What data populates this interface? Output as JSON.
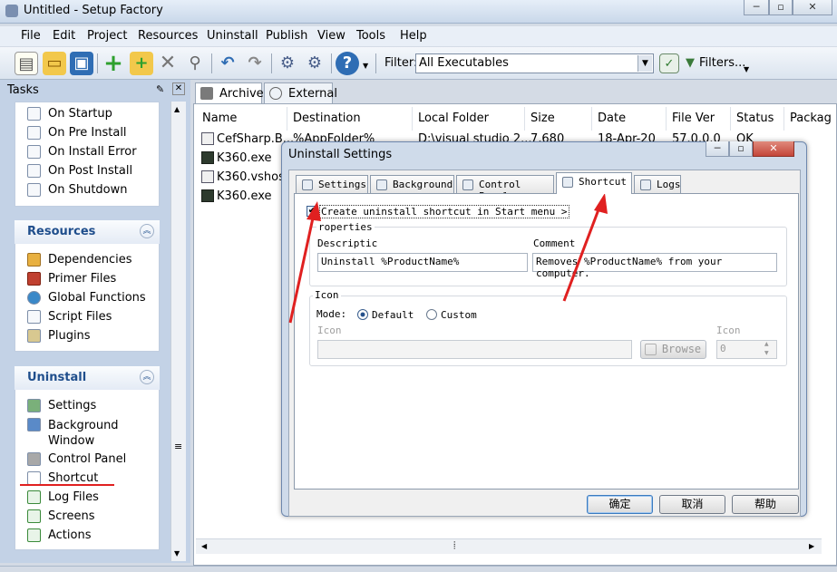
{
  "window": {
    "title": "Untitled - Setup Factory",
    "btn_min": "─",
    "btn_max": "▫",
    "btn_close": "✕"
  },
  "menu": [
    "File",
    "Edit",
    "Project",
    "Resources",
    "Uninstall",
    "Publish",
    "View",
    "Tools",
    "Help"
  ],
  "toolbar": {
    "icons": [
      "new-file-icon",
      "open-folder-icon",
      "save-icon",
      "add-icon",
      "add-folder-icon",
      "remove-icon",
      "search-icon",
      "undo-icon",
      "redo-icon",
      "build-gear-icon",
      "settings-gear-icon",
      "help-icon"
    ],
    "filter_label": "Filter:",
    "filter_value": "All Executables",
    "filters_button": "Filters..."
  },
  "tasks": {
    "title": "Tasks",
    "actions_items": [
      "On Startup",
      "On Pre Install",
      "On Install Error",
      "On Post Install",
      "On Shutdown"
    ],
    "resources": {
      "title": "Resources",
      "items": [
        "Dependencies",
        "Primer Files",
        "Global Functions",
        "Script Files",
        "Plugins"
      ]
    },
    "uninstall": {
      "title": "Uninstall",
      "items": [
        "Settings",
        "Background Window",
        "Control Panel",
        "Shortcut",
        "Log Files",
        "Screens",
        "Actions"
      ]
    }
  },
  "main": {
    "tabs": [
      "Archive",
      "External"
    ],
    "columns": [
      "Name",
      "Destination",
      "Local Folder",
      "Size",
      "Date",
      "File Ver",
      "Status",
      "Packag"
    ],
    "rows": [
      {
        "name": "CefSharp.B...",
        "destination": "%AppFolder%",
        "local": "D:\\visual studio 2...",
        "size": "7,680",
        "date": "18-Apr-20",
        "ver": "57.0.0.0",
        "status": "OK"
      },
      {
        "name": "K360.exe",
        "destination": "",
        "local": "",
        "size": "",
        "date": "",
        "ver": "",
        "status": ""
      },
      {
        "name": "K360.vshos...",
        "destination": "",
        "local": "",
        "size": "",
        "date": "",
        "ver": "",
        "status": ""
      },
      {
        "name": "K360.exe",
        "destination": "",
        "local": "",
        "size": "",
        "date": "",
        "ver": "",
        "status": ""
      }
    ]
  },
  "dialog": {
    "title": "Uninstall Settings",
    "tabs": [
      "Settings",
      "Background",
      "Control Panel",
      "Shortcut",
      "Logs"
    ],
    "checkbox_label": "Create uninstall shortcut in Start menu >",
    "properties_label": "roperties",
    "description_label": "Descriptic",
    "description_value": "Uninstall %ProductName%",
    "comment_label": "Comment",
    "comment_value": "Removes %ProductName% from your computer.",
    "icon_group_label": "Icon",
    "mode_label": "Mode:",
    "mode_default": "Default",
    "mode_custom": "Custom",
    "icon_field_label": "Icon",
    "browse_label": "Browse",
    "icon_index_label": "Icon",
    "icon_index_value": "0",
    "ok": "确定",
    "cancel": "取消",
    "help": "帮助"
  }
}
